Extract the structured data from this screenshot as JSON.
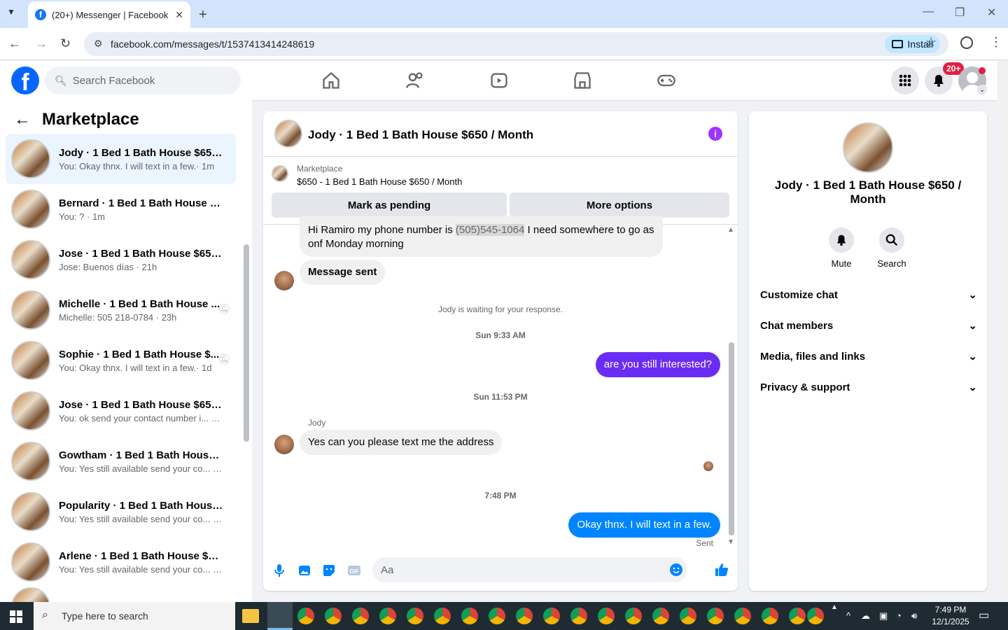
{
  "browser": {
    "tab_title": "(20+) Messenger | Facebook",
    "url": "facebook.com/messages/t/1537413414248619",
    "install_label": "Install"
  },
  "fb": {
    "search_placeholder": "Search Facebook",
    "notif_count": "20+"
  },
  "sidebar": {
    "title": "Marketplace",
    "items": [
      {
        "name": "Jody · 1 Bed 1 Bath House $650 /...",
        "snippet": "You: Okay thnx. I will text in a few.· 1m",
        "muted": false
      },
      {
        "name": "Bernard · 1 Bed 1 Bath House $6...",
        "snippet": "You: ? · 1m",
        "muted": false
      },
      {
        "name": "Jose · 1 Bed 1 Bath House $650 /...",
        "snippet": "Jose: Buenos días · 21h",
        "muted": false
      },
      {
        "name": "Michelle · 1 Bed 1 Bath House ...",
        "snippet": "Michelle: 505 218-0784 · 23h",
        "muted": true
      },
      {
        "name": "Sophie · 1 Bed 1 Bath House $...",
        "snippet": "You: Okay thnx. I will text in a few.· 1d",
        "muted": true
      },
      {
        "name": "Jose · 1 Bed 1 Bath House $650 /...",
        "snippet": "You: ok send your contact number i... · 1d",
        "muted": false
      },
      {
        "name": "Gowtham · 1 Bed 1 Bath House $...",
        "snippet": "You: Yes still available send your co... · 1d",
        "muted": false
      },
      {
        "name": "Popularity · 1 Bed 1 Bath House ...",
        "snippet": "You: Yes still available send your co... · 1d",
        "muted": false
      },
      {
        "name": "Arlene · 1 Bed 1 Bath House $65...",
        "snippet": "You: Yes still available send your co... · 1d",
        "muted": false
      }
    ]
  },
  "chat": {
    "title": "Jody · 1 Bed 1 Bath House $650 / Month",
    "marketplace_label": "Marketplace",
    "listing": "$650 - 1 Bed 1 Bath House $650 / Month",
    "mark_pending": "Mark as pending",
    "more_options": "More options",
    "msg1_a": "Hi Ramiro my phone number is ",
    "msg1_phone": "(505)545-1064",
    "msg1_b": " I need somewhere to go as",
    "msg1_c": "onf Monday morning",
    "msg2": "Message sent",
    "waiting": "Jody is waiting for your response.",
    "ts1": "Sun 9:33 AM",
    "out1": "are you still interested?",
    "ts2": "Sun 11:53 PM",
    "sender": "Jody",
    "msg3": "Yes can you please text me the address",
    "ts3": "7:48 PM",
    "out2": "Okay thnx. I will text in a few.",
    "sent": "Sent",
    "input_placeholder": "Aa"
  },
  "details": {
    "title": "Jody · 1 Bed 1 Bath House $650 / Month",
    "mute": "Mute",
    "search": "Search",
    "sections": [
      "Customize chat",
      "Chat members",
      "Media, files and links",
      "Privacy & support"
    ]
  },
  "taskbar": {
    "search_placeholder": "Type here to search",
    "time": "7:49 PM",
    "date": "12/1/2025"
  },
  "colors": {
    "fb_blue": "#0866ff",
    "messenger_blue": "#0084ff",
    "purple_bubble": "#6a2cf5",
    "info_purple": "#a033ff"
  }
}
